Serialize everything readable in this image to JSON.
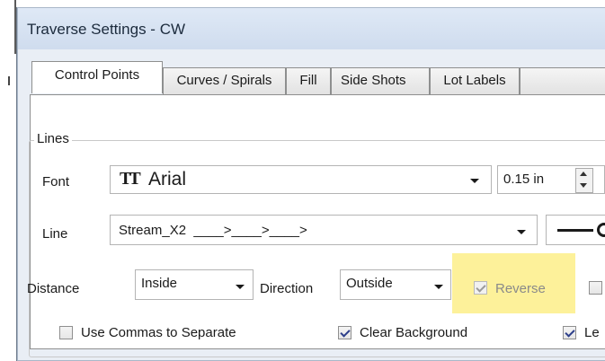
{
  "window": {
    "title": "Traverse Settings - CW"
  },
  "tabs": [
    {
      "label": "Control Points",
      "active": true
    },
    {
      "label": "Curves / Spirals"
    },
    {
      "label": "Fill"
    },
    {
      "label": "Side Shots"
    },
    {
      "label": "Lot Labels"
    }
  ],
  "lines_group": {
    "label": "Lines",
    "font": {
      "label": "Font",
      "icon": "truetype-font-icon",
      "value": "Arial",
      "size": "0.15 in"
    },
    "line": {
      "label": "Line",
      "value": "Stream_X2  ____>____>____>"
    },
    "distance": {
      "label": "Distance",
      "value": "Inside"
    },
    "direction": {
      "label": "Direction",
      "value": "Outside"
    },
    "reverse": {
      "label": "Reverse",
      "checked": true,
      "enabled": false
    },
    "use_commas": {
      "label": "Use Commas to Separate",
      "checked": false
    },
    "clear_background": {
      "label": "Clear Background",
      "checked": true
    },
    "third_option": {
      "label": "Le",
      "checked": true
    }
  },
  "colors": {
    "highlight": "#fdf19a",
    "title_bar": "#dfe9f6",
    "panel": "#ffffff"
  }
}
